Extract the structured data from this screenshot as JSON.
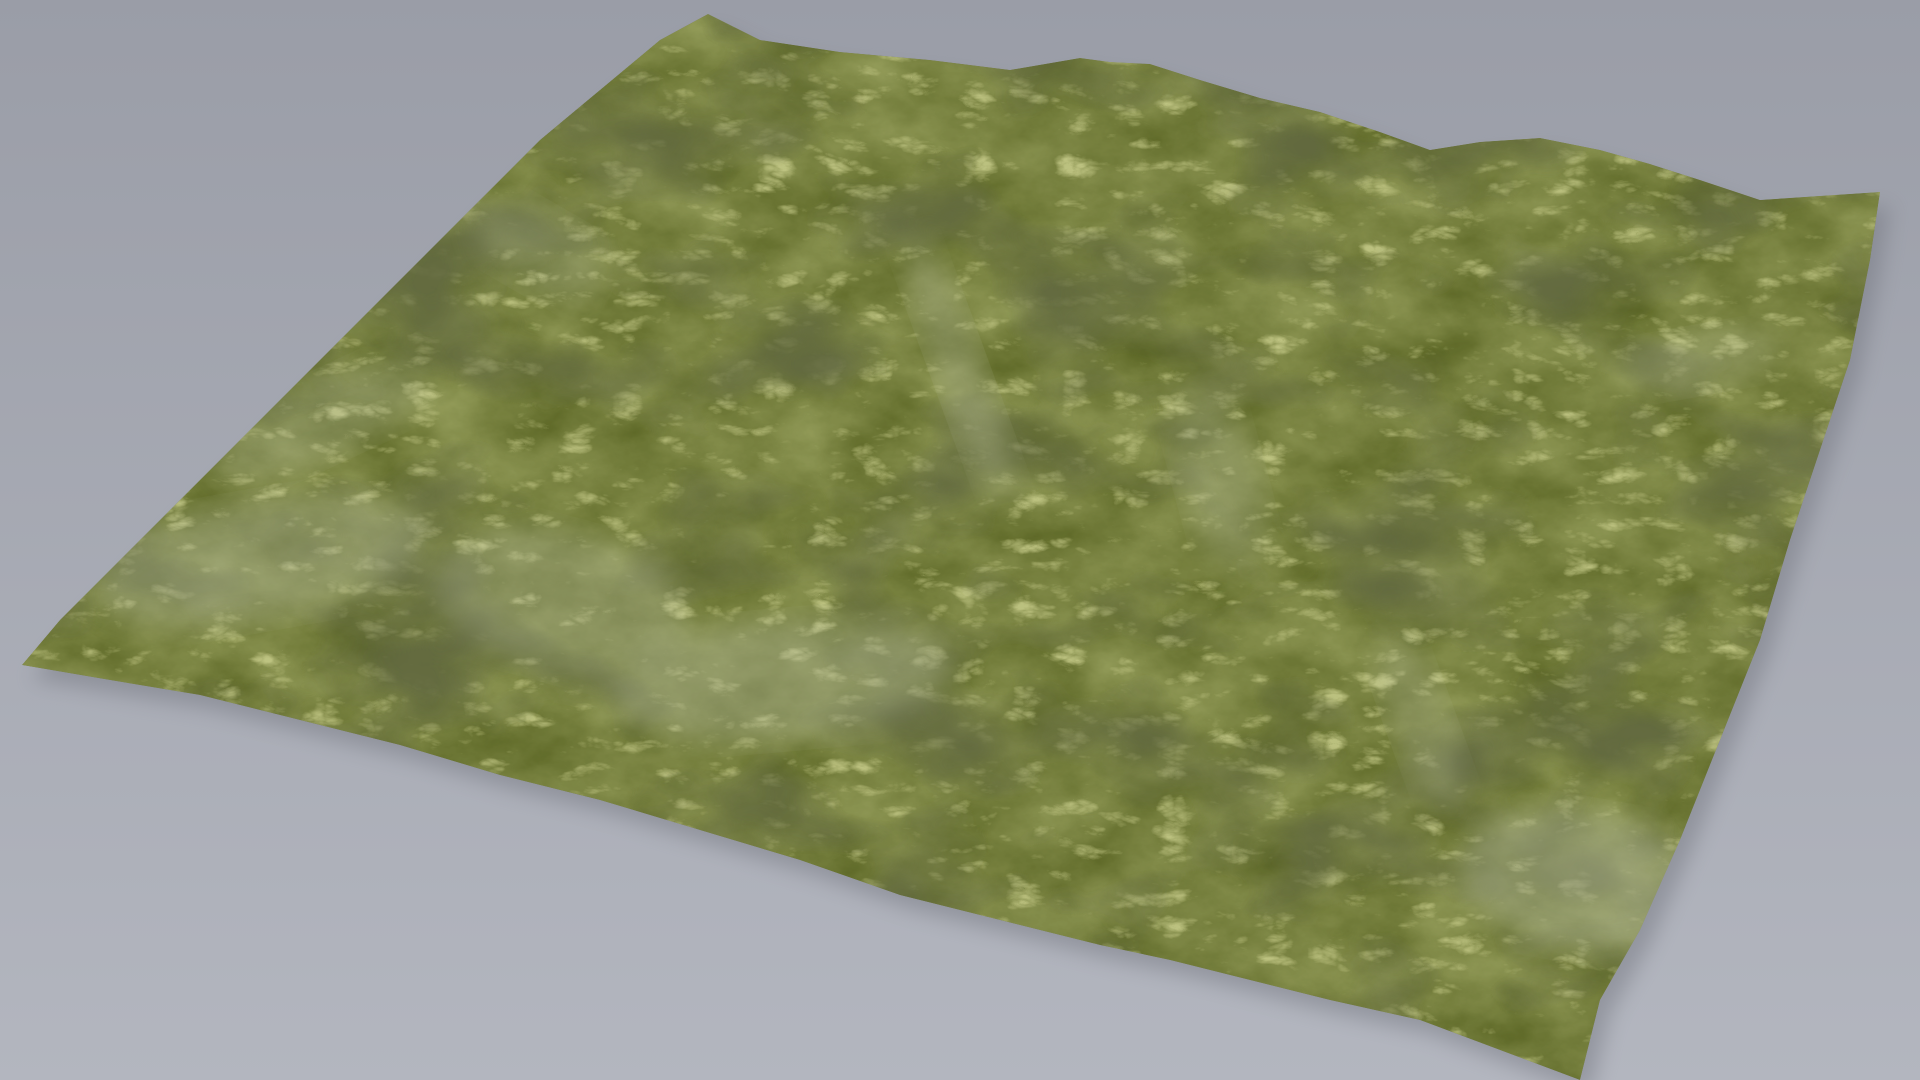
{
  "scene": {
    "subject": "terrain-heightmap-render",
    "colors": {
      "background_top": "#9a9da7",
      "background_bottom": "#b3b6bf",
      "terrain_base": "#55601f",
      "terrain_light": "#8f9a3c",
      "terrain_dark": "#262c10",
      "rock": "#b6bba3",
      "shadow": "#6e717a"
    }
  }
}
